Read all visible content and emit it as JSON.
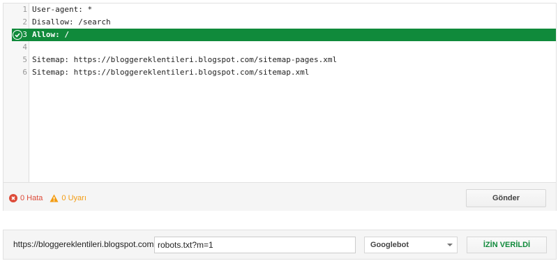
{
  "editor": {
    "lines": [
      {
        "num": "1",
        "text": "User-agent: *"
      },
      {
        "num": "2",
        "text": "Disallow: /search"
      },
      {
        "num": "3",
        "text": "Allow: /"
      },
      {
        "num": "4",
        "text": ""
      },
      {
        "num": "5",
        "text": "Sitemap: https://bloggereklentileri.blogspot.com/sitemap-pages.xml"
      },
      {
        "num": "6",
        "text": "Sitemap: https://bloggereklentileri.blogspot.com/sitemap.xml"
      }
    ],
    "active_line": 3,
    "active_icon": "check-circle-icon",
    "highlight_color": "#108a3b"
  },
  "status": {
    "errors_label": "0 Hata",
    "warnings_label": "0 Uyarı",
    "error_icon": "error-x-icon",
    "warning_icon": "warning-triangle-icon",
    "error_color": "#dd4b39",
    "warning_color": "#f39c12",
    "submit_label": "Gönder"
  },
  "tester": {
    "base_url": "https://bloggereklentileri.blogspot.com.tr/",
    "path_value": "robots.txt?m=1",
    "user_agent": "Googlebot",
    "result_label": "İZİN VERİLDİ",
    "result_color": "#108a3b"
  }
}
